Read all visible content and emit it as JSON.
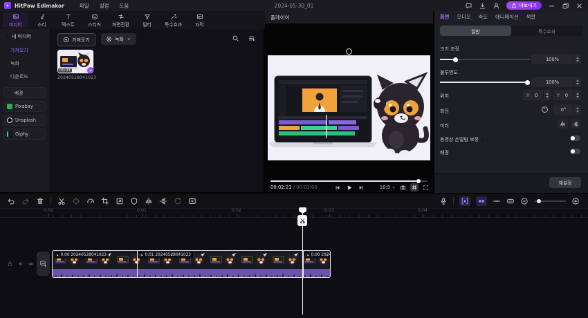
{
  "colors": {
    "accent": "#9b4dff",
    "export_gradient": "#a64bf4",
    "clip_waveform_bg": "#6b54a8",
    "clip_waveform_dark": "#2c2154",
    "selection": "#ffffff",
    "panel_bg": "#1e1e25"
  },
  "titlebar": {
    "app_name": "HitPaw Edimakor",
    "menus": [
      "파일",
      "설정",
      "도움"
    ],
    "project_title": "2024-05-30_01",
    "export_label": "내보내기"
  },
  "ribbon": {
    "tabs": [
      {
        "label": "미디어",
        "active": true
      },
      {
        "label": "소리"
      },
      {
        "label": "텍스트"
      },
      {
        "label": "스티커"
      },
      {
        "label": "화면전환"
      },
      {
        "label": "필터"
      },
      {
        "label": "특수효과"
      },
      {
        "label": "자막"
      }
    ]
  },
  "sidebar": {
    "my_media": "내 미디어",
    "items": [
      "가져오기",
      "녹화",
      "다운로드"
    ],
    "active_item": "가져오기",
    "groups": [
      "배경",
      "Pixabay",
      "Unsplash",
      "Giphy"
    ]
  },
  "media_panel": {
    "import_button": "가져오기",
    "record_button": "녹화",
    "item_name": "20240528041023",
    "item_duration": "00:03"
  },
  "player": {
    "title": "플레이어",
    "current_time": "00:02:21",
    "time_separator": " / ",
    "total_time": "00:03:00",
    "aspect_ratio": "16:9"
  },
  "properties": {
    "tabs": [
      "화면",
      "오디오",
      "속도",
      "애니메이션",
      "색깔"
    ],
    "active_tab": "화면",
    "sub_tabs": [
      "일반",
      "특수효과"
    ],
    "active_sub_tab": "일반",
    "scale_label": "크기 조정",
    "scale_value": "100%",
    "opacity_label": "불투명도",
    "opacity_value": "100%",
    "position_label": "위치",
    "x_label": "X",
    "x_value": "0",
    "y_label": "Y",
    "y_value": "0",
    "rotation_label": "회전",
    "rotation_value": "0°",
    "mirror_label": "미러",
    "stabilization_label": "동영상 손떨림 보정",
    "background_label": "배경",
    "reset_button": "재설정"
  },
  "timeline": {
    "ruler_labels": [
      "0:00",
      "0:01",
      "0:02",
      "0:03",
      "0:04"
    ],
    "clip_segments": [
      {
        "label": "0:00 20240528041023"
      },
      {
        "label": "0:01 20240528041023"
      },
      {
        "label": "0:00 2024"
      }
    ]
  }
}
